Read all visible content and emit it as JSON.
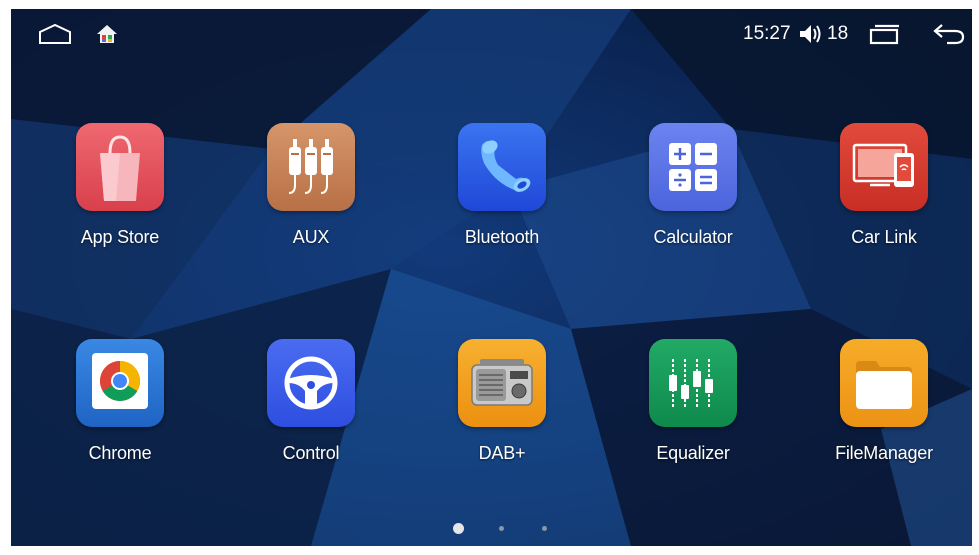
{
  "status_bar": {
    "time": "15:27",
    "volume_level": "18",
    "icons": [
      "home-icon",
      "launcher-icon",
      "volume-icon",
      "recent-apps-icon",
      "back-icon"
    ]
  },
  "apps": [
    {
      "label": "App Store",
      "icon": "shopping-bag-icon",
      "color": "#e0505a"
    },
    {
      "label": "AUX",
      "icon": "audio-plugs-icon",
      "color": "#c98454"
    },
    {
      "label": "Bluetooth",
      "icon": "bluetooth-handset-icon",
      "color": "#2a5be8"
    },
    {
      "label": "Calculator",
      "icon": "calculator-icon",
      "color": "#5c74e6"
    },
    {
      "label": "Car Link",
      "icon": "phone-screen-mirror-icon",
      "color": "#d63a2e"
    },
    {
      "label": "Chrome",
      "icon": "chrome-icon",
      "color": "#2a78d8"
    },
    {
      "label": "Control",
      "icon": "steering-wheel-icon",
      "color": "#3a5ee8"
    },
    {
      "label": "DAB+",
      "icon": "radio-icon",
      "color": "#f3a020"
    },
    {
      "label": "Equalizer",
      "icon": "equalizer-sliders-icon",
      "color": "#169a5a"
    },
    {
      "label": "FileManager",
      "icon": "folder-icon",
      "color": "#f3a020"
    }
  ],
  "page_indicator": {
    "pages": 3,
    "current": 1
  }
}
